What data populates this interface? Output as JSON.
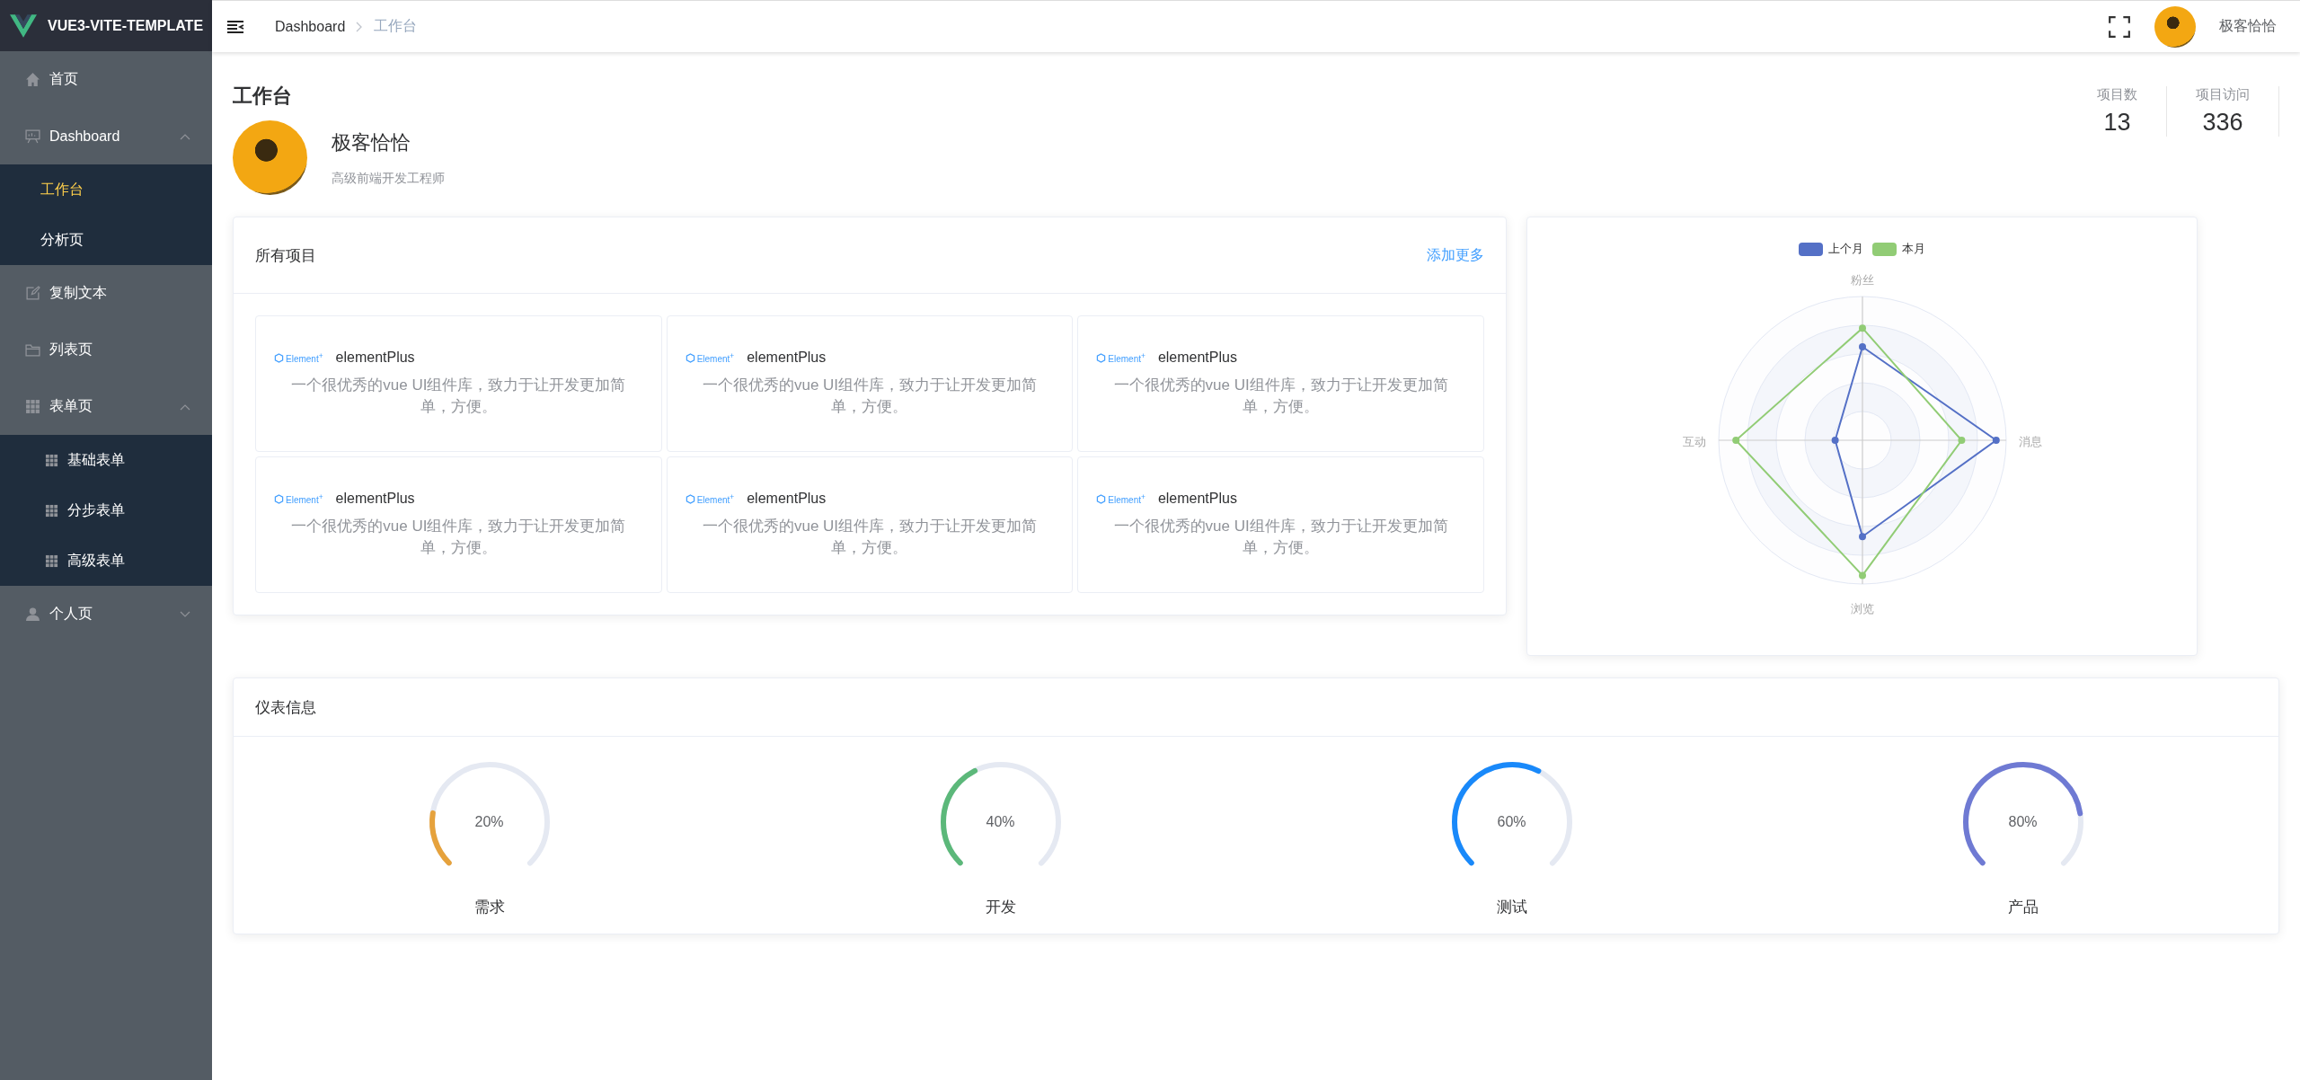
{
  "sidebar": {
    "logo_text": "VUE3-VITE-TEMPLATE",
    "items": [
      {
        "label": "首页",
        "selected": false
      },
      {
        "label": "Dashboard",
        "selected": false,
        "expanded": true,
        "children": [
          {
            "label": "工作台",
            "selected": true
          },
          {
            "label": "分析页",
            "selected": false
          }
        ]
      },
      {
        "label": "复制文本",
        "selected": false
      },
      {
        "label": "列表页",
        "selected": false
      },
      {
        "label": "表单页",
        "selected": false,
        "expanded": true,
        "children": [
          {
            "label": "基础表单",
            "selected": false
          },
          {
            "label": "分步表单",
            "selected": false
          },
          {
            "label": "高级表单",
            "selected": false
          }
        ]
      },
      {
        "label": "个人页",
        "selected": false,
        "expanded": false
      }
    ]
  },
  "header": {
    "breadcrumb": [
      {
        "label": "Dashboard",
        "selected": false
      },
      {
        "label": "工作台",
        "selected": true
      }
    ],
    "user_name": "极客恰恰"
  },
  "page": {
    "title": "工作台",
    "profile": {
      "name": "极客恰恰",
      "role": "高级前端开发工程师"
    },
    "stats": [
      {
        "label": "项目数",
        "value": "13"
      },
      {
        "label": "项目访问",
        "value": "336"
      }
    ]
  },
  "projects": {
    "title": "所有项目",
    "link": "添加更多",
    "items": [
      {
        "logo": "Element$^{+}$",
        "name": "elementPlus",
        "description": "一个很优秀的vue UI组件库，致力于让开发更加简单，方便。"
      },
      {
        "logo": "Element$^{+}$",
        "name": "elementPlus",
        "description": "一个很优秀的vue UI组件库，致力于让开发更加简单，方便。"
      },
      {
        "logo": "Element$^{+}$",
        "name": "elementPlus",
        "description": "一个很优秀的vue UI组件库，致力于让开发更加简单，方便。"
      },
      {
        "logo": "Element$^{+}$",
        "name": "elementPlus",
        "description": "一个很优秀的vue UI组件库，致力于让开发更加简单，方便。"
      },
      {
        "logo": "Element$^{+}$",
        "name": "elementPlus",
        "description": "一个很优秀的vue UI组件库，致力于让开发更加简单，方便。"
      },
      {
        "logo": "Element$^{+}$",
        "name": "elementPlus",
        "description": "一个很优秀的vue UI组件库，致力于让开发更加简单，方便。"
      }
    ]
  },
  "radar": {
    "legend": [
      {
        "name": "上个月",
        "color": "#5470c6"
      },
      {
        "name": "本月",
        "color": "#91cc75"
      }
    ],
    "axes": [
      "粉丝",
      "消息",
      "浏览",
      "互动"
    ]
  },
  "gauges": {
    "title": "仪表信息",
    "items": [
      {
        "label": "需求",
        "reading": "20%",
        "level": 0.2,
        "color": "#e6a23c"
      },
      {
        "label": "开发",
        "reading": "40%",
        "level": 0.4,
        "color": "#5cb87a"
      },
      {
        "label": "测试",
        "reading": "60%",
        "level": 0.6,
        "color": "#1989fa"
      },
      {
        "label": "产品",
        "reading": "80%",
        "level": 0.8,
        "color": "#6f7ad3"
      }
    ]
  }
}
